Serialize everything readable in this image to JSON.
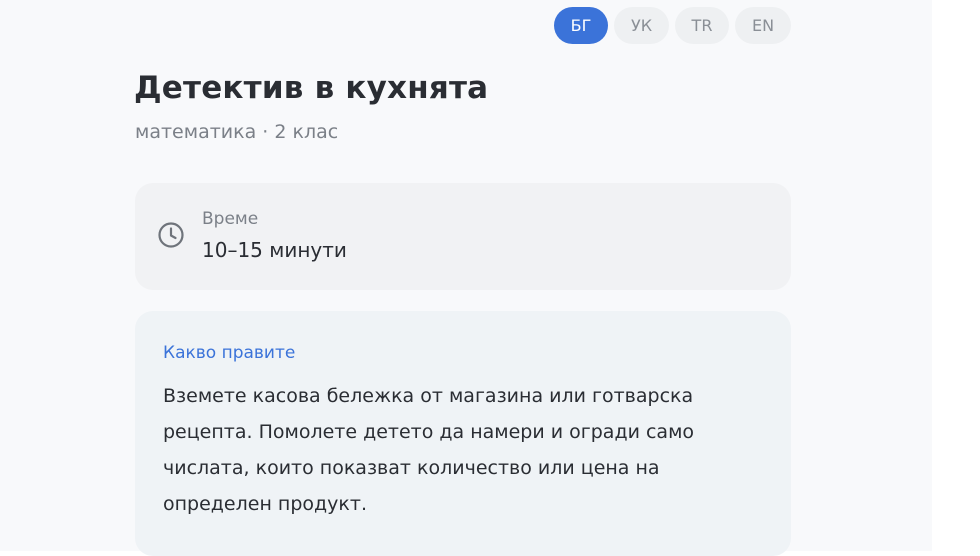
{
  "languages": [
    {
      "code": "БГ",
      "active": true
    },
    {
      "code": "УК",
      "active": false
    },
    {
      "code": "TR",
      "active": false
    },
    {
      "code": "EN",
      "active": false
    }
  ],
  "activity": {
    "title": "Детектив в кухнята",
    "subtitle": "математика · 2 клас"
  },
  "time_card": {
    "icon": "clock-icon",
    "label": "Време",
    "value": "10–15 минути"
  },
  "what_card": {
    "heading": "Какво правите",
    "text": "Вземете касова бележка от магазина или готварска рецепта. Помолете детето да намери и огради само числата, които показват количество или цена на определен продукт."
  },
  "colors": {
    "accent": "#3b73d9",
    "page_background": "#f8f9fb",
    "card_background": "#f1f2f4",
    "info_card_background": "#eff3f6"
  }
}
